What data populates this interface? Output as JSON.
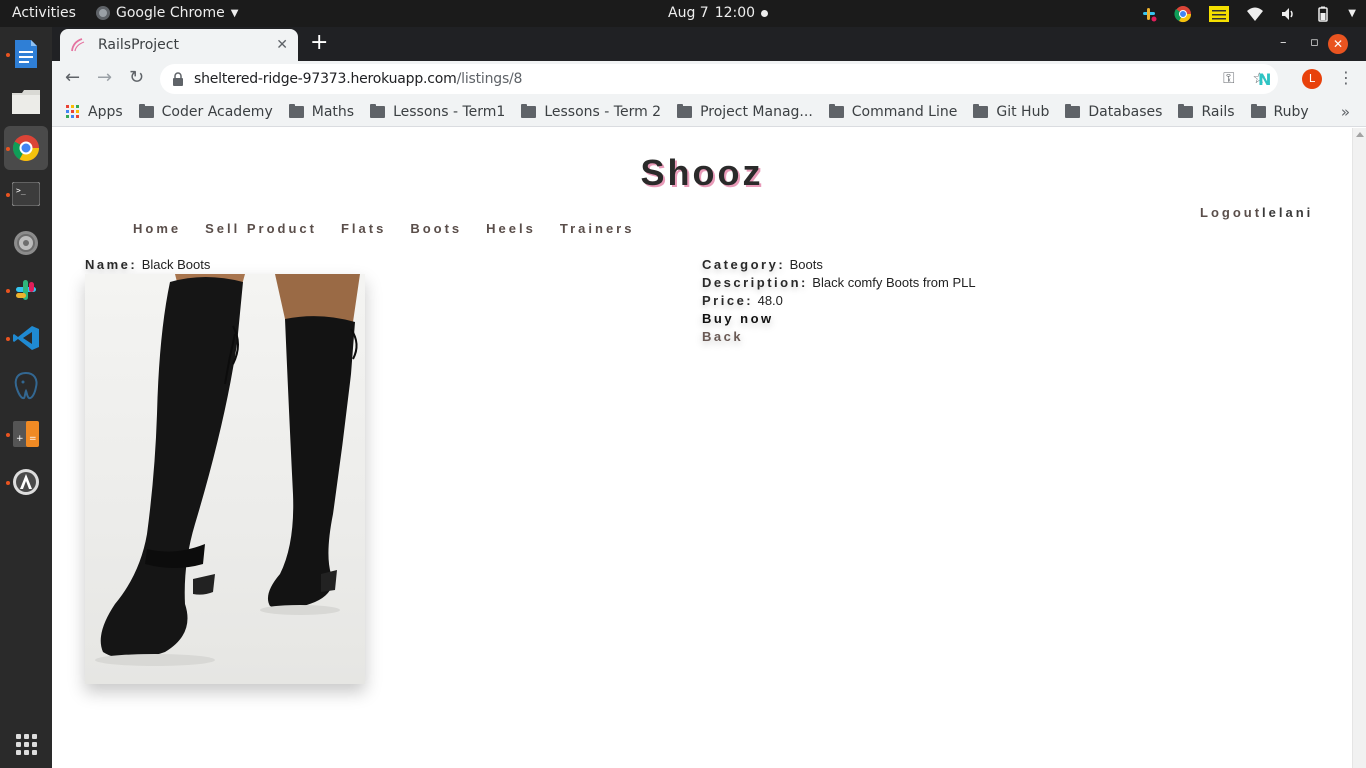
{
  "system_bar": {
    "activities": "Activities",
    "app_name": "Google Chrome",
    "date": "Aug 7",
    "time": "12:00"
  },
  "dock": {
    "apps": [
      "text-editor-icon",
      "files-icon",
      "chrome-icon",
      "terminal-icon",
      "settings-icon",
      "slack-icon",
      "vscode-icon",
      "postgres-icon",
      "calculator-icon",
      "software-updater-icon"
    ]
  },
  "browser": {
    "tab_title": "RailsProject",
    "url_host": "sheltered-ridge-97373.herokuapp.com",
    "url_path": "/listings/8",
    "profile_initial": "L",
    "bookmarks": [
      "Apps",
      "Coder Academy",
      "Maths",
      "Lessons - Term1",
      "Lessons - Term 2",
      "Project Manag...",
      "Command Line",
      "Git Hub",
      "Databases",
      "Rails",
      "Ruby"
    ],
    "bookmarks_more": "»"
  },
  "site": {
    "brand": "Shooz",
    "nav": [
      "Home",
      "Sell Product",
      "Flats",
      "Boots",
      "Heels",
      "Trainers"
    ],
    "logout": "Logout",
    "username": "lelani"
  },
  "listing": {
    "name_label": "Name:",
    "name": "Black Boots",
    "category_label": "Category:",
    "category": "Boots",
    "description_label": "Description:",
    "description": "Black comfy Boots from PLL",
    "price_label": "Price:",
    "price": "48.0",
    "buy_now": "Buy now",
    "back": "Back"
  },
  "colors": {
    "brand_shadow": "#e89ab8",
    "nav_text": "#5a4e4a",
    "accent": "#e95420"
  }
}
